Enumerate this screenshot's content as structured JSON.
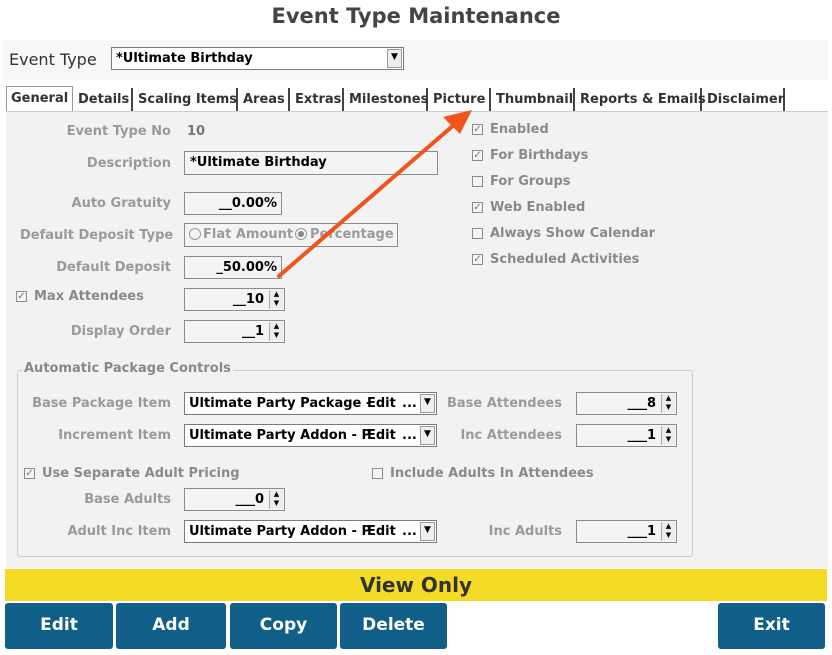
{
  "window": {
    "title": "Event Type Maintenance"
  },
  "event_type": {
    "label": "Event Type",
    "value": "*Ultimate Birthday"
  },
  "tabs": [
    {
      "label": "General"
    },
    {
      "label": "Details"
    },
    {
      "label": "Scaling Items"
    },
    {
      "label": "Areas"
    },
    {
      "label": "Extras"
    },
    {
      "label": "Milestones"
    },
    {
      "label": "Picture"
    },
    {
      "label": "Thumbnail"
    },
    {
      "label": "Reports & Emails"
    },
    {
      "label": "Disclaimer"
    }
  ],
  "general": {
    "event_type_no": {
      "label": "Event Type No",
      "value": "10"
    },
    "description": {
      "label": "Description",
      "value": "*Ultimate Birthday"
    },
    "auto_gratuity": {
      "label": "Auto Gratuity",
      "value": "__0.00%"
    },
    "default_deposit_type": {
      "label": "Default Deposit Type",
      "options": [
        "Flat Amount",
        "Percentage"
      ],
      "selected": "Percentage"
    },
    "default_deposit": {
      "label": "Default Deposit",
      "value": "_50.00%"
    },
    "max_attendees": {
      "label": "Max Attendees",
      "checked": true,
      "value": "__10"
    },
    "display_order": {
      "label": "Display Order",
      "value": "__1"
    },
    "flags": [
      {
        "label": "Enabled",
        "checked": true
      },
      {
        "label": "For Birthdays",
        "checked": true
      },
      {
        "label": "For Groups",
        "checked": false
      },
      {
        "label": "Web Enabled",
        "checked": true
      },
      {
        "label": "Always Show Calendar",
        "checked": false
      },
      {
        "label": "Scheduled Activities",
        "checked": true
      }
    ]
  },
  "package_controls": {
    "title": "Automatic Package Controls",
    "base_package": {
      "label": "Base Package Item",
      "value": "Ultimate Party Package -",
      "edit": "Edit",
      "more": "..."
    },
    "increment": {
      "label": "Increment Item",
      "value": "Ultimate Party Addon - P",
      "edit": "Edit",
      "more": "..."
    },
    "base_attendees": {
      "label": "Base Attendees",
      "value": "___8"
    },
    "inc_attendees": {
      "label": "Inc Attendees",
      "value": "___1"
    },
    "separate_adult": {
      "label": "Use Separate Adult Pricing",
      "checked": true
    },
    "include_adults": {
      "label": "Include Adults In Attendees",
      "checked": false
    },
    "base_adults": {
      "label": "Base Adults",
      "value": "___0"
    },
    "adult_inc_item": {
      "label": "Adult Inc Item",
      "value": "Ultimate Party Addon - P",
      "edit": "Edit",
      "more": "..."
    },
    "inc_adults": {
      "label": "Inc Adults",
      "value": "___1"
    }
  },
  "banner": {
    "text": "View Only",
    "color": "#f4db26"
  },
  "buttons": {
    "edit": "Edit",
    "add": "Add",
    "copy": "Copy",
    "delete": "Delete",
    "exit": "Exit",
    "color": "#0f5f88"
  },
  "annotation": {
    "arrow_color": "#f0531c"
  }
}
